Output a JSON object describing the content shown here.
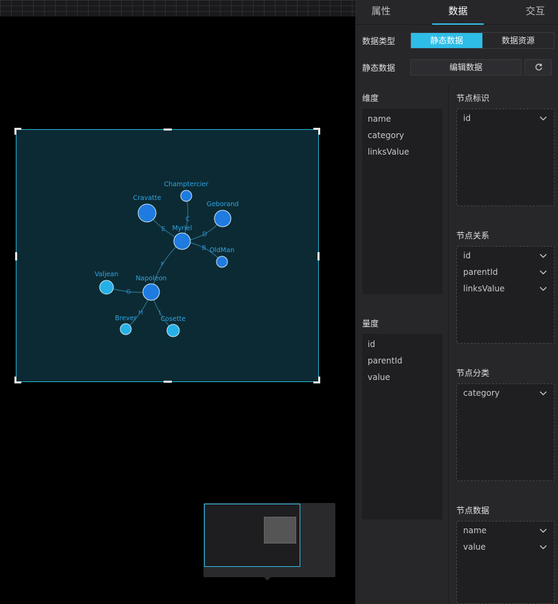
{
  "panel": {
    "tabs": {
      "attributes": "属性",
      "data": "数据",
      "interaction": "交互"
    },
    "data_type_label": "数据类型",
    "data_type_options": {
      "static": "静态数据",
      "resource": "数据资源"
    },
    "static_data_label": "静态数据",
    "edit_data_button": "编辑数据",
    "dimensions": {
      "title": "维度",
      "items": [
        "name",
        "category",
        "linksValue"
      ]
    },
    "measures": {
      "title": "量度",
      "items": [
        "id",
        "parentId",
        "value"
      ]
    },
    "node_id": {
      "title": "节点标识",
      "items": [
        "id"
      ]
    },
    "node_relation": {
      "title": "节点关系",
      "items": [
        "id",
        "parentId",
        "linksValue"
      ]
    },
    "node_category": {
      "title": "节点分类",
      "items": [
        "category"
      ]
    },
    "node_data": {
      "title": "节点数据",
      "items": [
        "name",
        "value"
      ]
    }
  },
  "colors": {
    "accent": "#2ebde6",
    "node_dark": "#1f7be0",
    "node_light": "#26b0e8",
    "chart_bg": "#0c2a33"
  },
  "chart_data": {
    "type": "graph",
    "nodes": [
      {
        "name": "Myriel",
        "size": 12,
        "group": 0
      },
      {
        "name": "Champtercier",
        "size": 8,
        "group": 0
      },
      {
        "name": "Cravatte",
        "size": 13,
        "group": 0
      },
      {
        "name": "Geborand",
        "size": 12,
        "group": 0
      },
      {
        "name": "OldMan",
        "size": 8,
        "group": 0
      },
      {
        "name": "Napoleon",
        "size": 12,
        "group": 0
      },
      {
        "name": "Valjean",
        "size": 10,
        "group": 1
      },
      {
        "name": "Brever",
        "size": 8,
        "group": 1
      },
      {
        "name": "Cosette",
        "size": 9,
        "group": 1
      }
    ],
    "links": [
      {
        "source": "Myriel",
        "target": "Champtercier",
        "label": "C"
      },
      {
        "source": "Myriel",
        "target": "Cravatte",
        "label": "E"
      },
      {
        "source": "Myriel",
        "target": "Geborand",
        "label": "D"
      },
      {
        "source": "Myriel",
        "target": "OldMan",
        "label": "B"
      },
      {
        "source": "Myriel",
        "target": "Napoleon",
        "label": "F"
      },
      {
        "source": "Napoleon",
        "target": "Valjean",
        "label": "G"
      },
      {
        "source": "Napoleon",
        "target": "Brever",
        "label": "H"
      },
      {
        "source": "Napoleon",
        "target": "Cosette",
        "label": "I"
      }
    ]
  }
}
